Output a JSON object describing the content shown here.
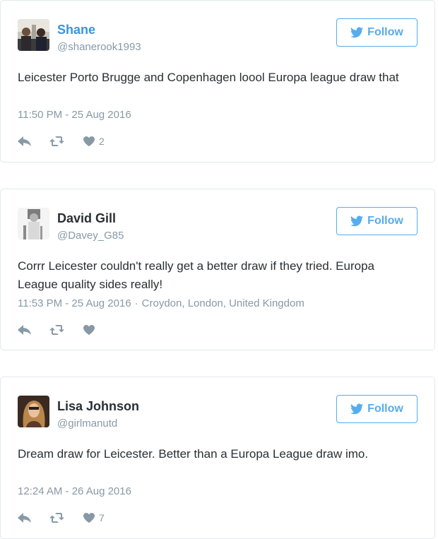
{
  "tweets": [
    {
      "name": "Shane",
      "name_color": "#3b94d9",
      "handle": "@shanerook1993",
      "follow_label": "Follow",
      "text": "Leicester Porto Brugge and Copenhagen loool Europa league draw that",
      "timestamp": "11:50 PM - 25 Aug 2016",
      "location": "",
      "likes": "2",
      "actions": {
        "reply": "reply-icon",
        "retweet": "retweet-icon",
        "like": "heart-icon"
      }
    },
    {
      "name": "David Gill",
      "name_color": "#292f33",
      "handle": "@Davey_G85",
      "follow_label": "Follow",
      "text": "Corrr Leicester couldn't really get a better draw if they tried. Europa League quality sides really!",
      "timestamp": "11:53 PM - 25 Aug 2016",
      "location": "Croydon, London, United Kingdom",
      "likes": "",
      "actions": {
        "reply": "reply-icon",
        "retweet": "retweet-icon",
        "like": "heart-icon"
      }
    },
    {
      "name": "Lisa Johnson",
      "name_color": "#292f33",
      "handle": "@girlmanutd",
      "follow_label": "Follow",
      "text": "Dream draw for Leicester. Better than a Europa League draw imo.",
      "timestamp": "12:24 AM - 26 Aug 2016",
      "location": "",
      "likes": "7",
      "actions": {
        "reply": "reply-icon",
        "retweet": "retweet-icon",
        "like": "heart-icon"
      }
    }
  ],
  "colors": {
    "accent": "#55acee",
    "muted": "#8899a6",
    "border": "#e1e8ed",
    "text": "#292f33"
  }
}
